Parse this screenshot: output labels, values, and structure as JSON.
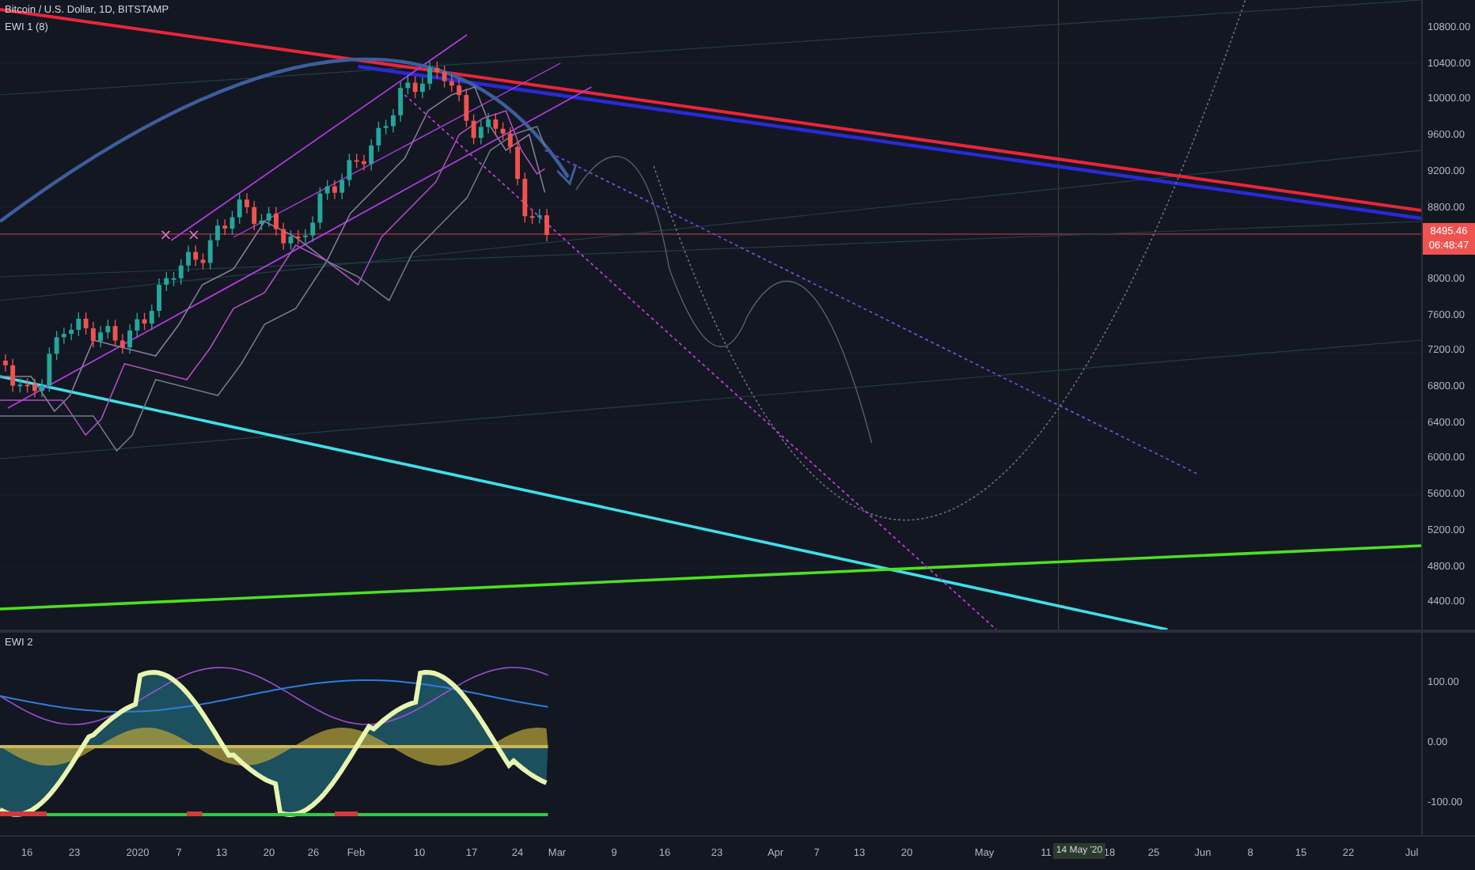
{
  "legend": {
    "symbol": "Bitcoin / U.S. Dollar, 1D, BITSTAMP",
    "indicator": "EWI 1 (8)"
  },
  "price_axis": {
    "labels": [
      "10800.00",
      "10400.00",
      "10000.00",
      "9600.00",
      "9200.00",
      "8800.00",
      "8000.00",
      "7600.00",
      "7200.00",
      "6800.00",
      "6400.00",
      "6000.00",
      "5600.00",
      "5200.00",
      "4800.00",
      "4400.00"
    ],
    "last_price": "8495.46",
    "countdown": "06:48:47"
  },
  "oscillator": {
    "title": "EWI 2",
    "axis_labels": [
      "100.00",
      "0.00",
      "-100.00"
    ]
  },
  "time_axis": {
    "labels": [
      "16",
      "23",
      "2020",
      "7",
      "13",
      "20",
      "26",
      "Feb",
      "10",
      "17",
      "24",
      "Mar",
      "9",
      "16",
      "23",
      "Apr",
      "7",
      "13",
      "20",
      "May",
      "11",
      "18",
      "25",
      "Jun",
      "8",
      "15",
      "22",
      "Jul"
    ],
    "crosshair_date": "14 May '20"
  }
}
